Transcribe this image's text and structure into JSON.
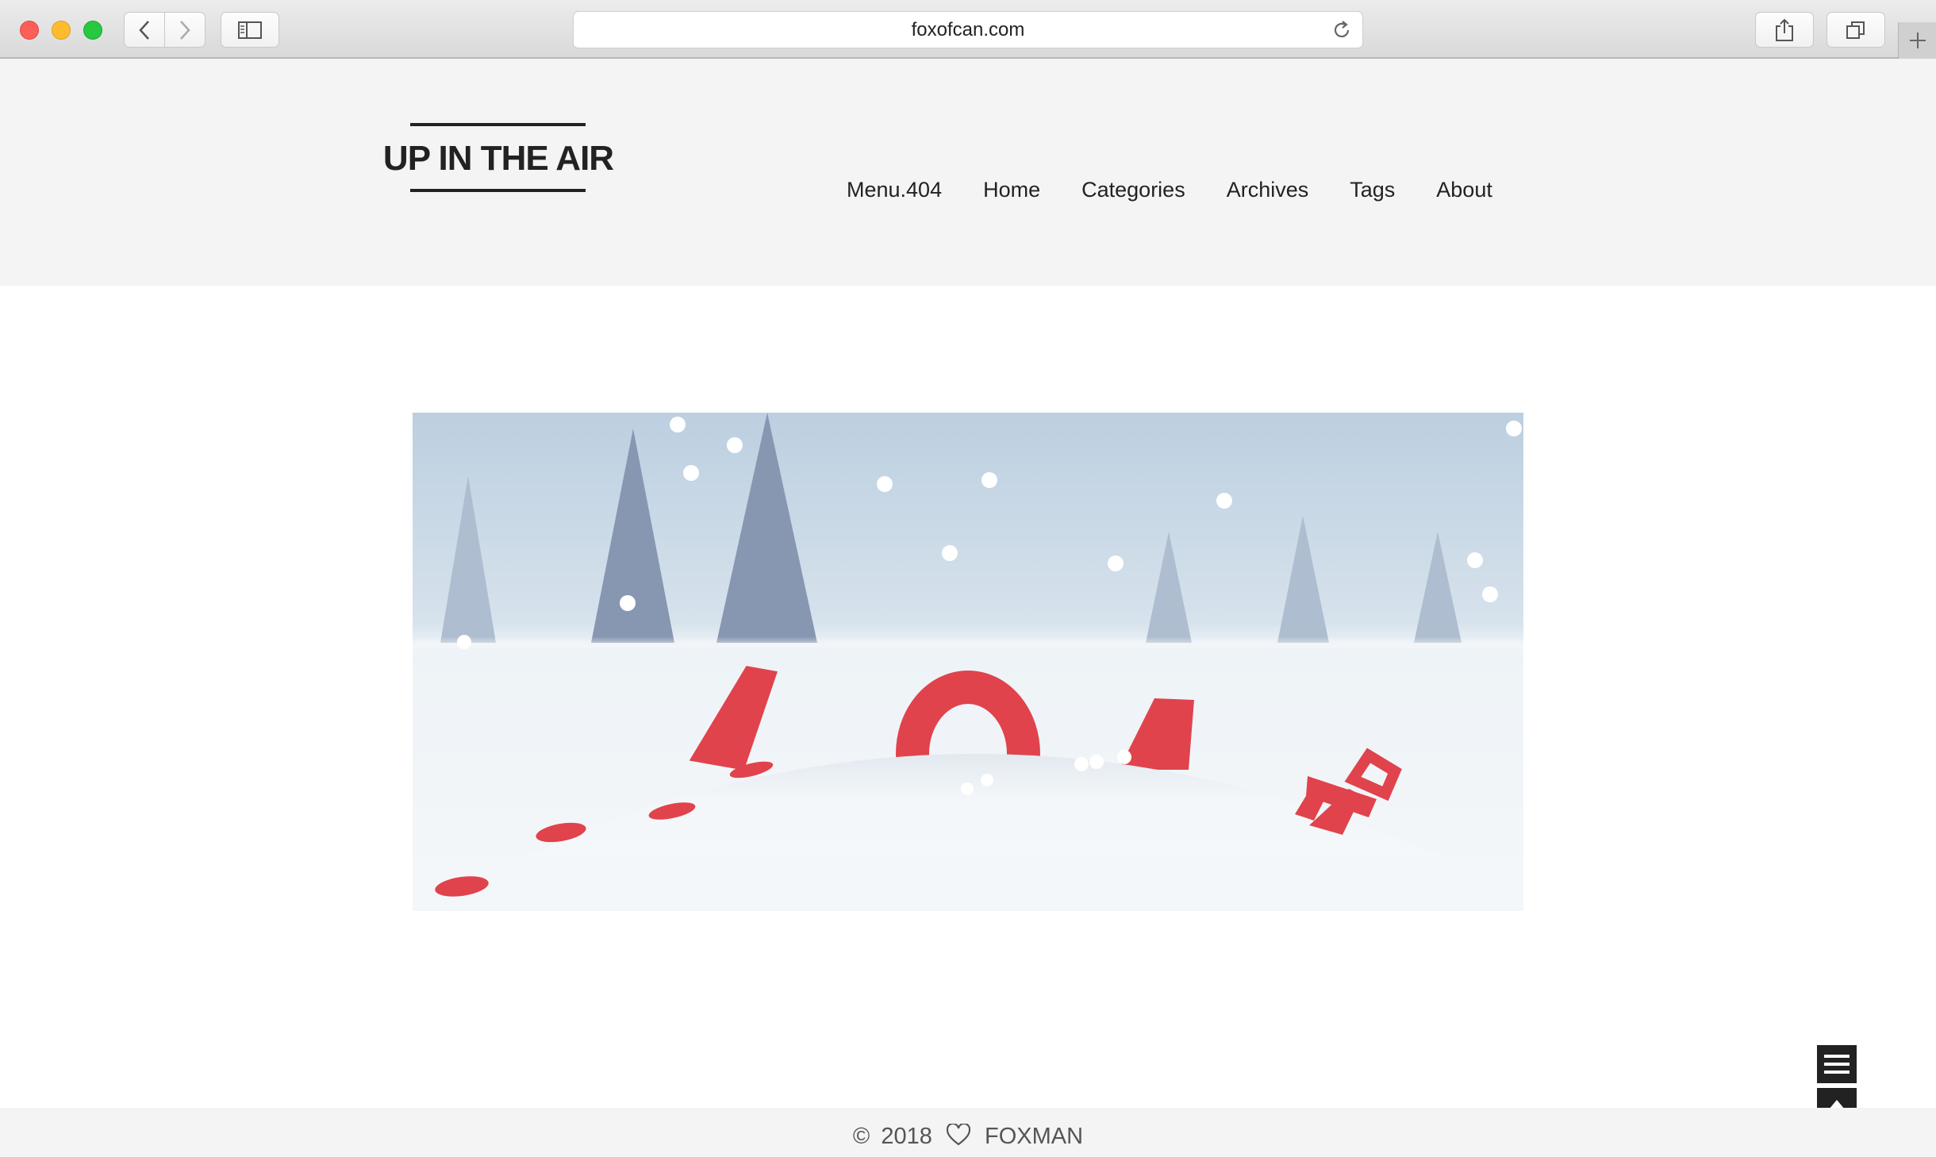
{
  "browser": {
    "url": "foxofcan.com",
    "icons": [
      "back-icon",
      "forward-icon",
      "sidebar-icon",
      "reload-icon",
      "share-icon",
      "tabs-icon",
      "plus-icon"
    ]
  },
  "site": {
    "logo": "UP IN THE AIR",
    "nav": [
      {
        "label": "Menu.404"
      },
      {
        "label": "Home"
      },
      {
        "label": "Categories"
      },
      {
        "label": "Archives"
      },
      {
        "label": "Tags"
      },
      {
        "label": "About"
      }
    ]
  },
  "illustration": {
    "error_code": "404",
    "accent_color": "#e0434c",
    "sky_color": "#bccfe0"
  },
  "footer": {
    "copyright": "©",
    "year": "2018",
    "author": "FOXMAN"
  },
  "floating": {
    "icons": [
      "menu-icon",
      "arrow-up-icon"
    ]
  }
}
